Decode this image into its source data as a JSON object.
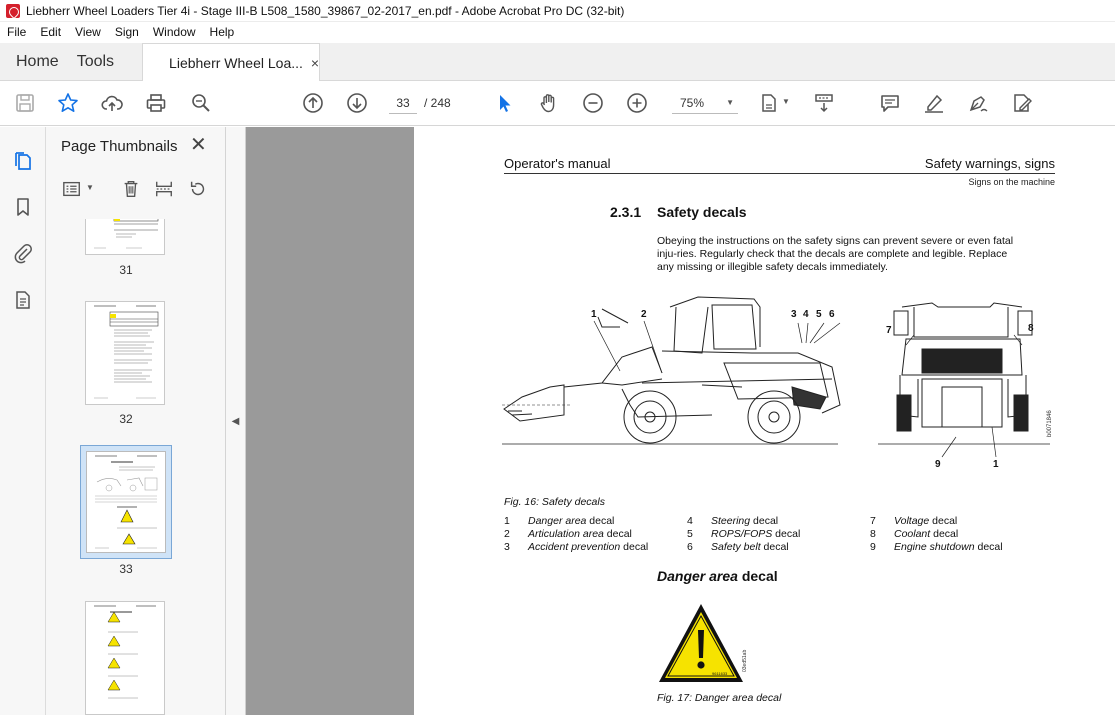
{
  "window": {
    "title": "Liebherr Wheel Loaders Tier 4i - Stage III-B L508_1580_39867_02-2017_en.pdf - Adobe Acrobat Pro DC (32-bit)"
  },
  "menu": [
    "File",
    "Edit",
    "View",
    "Sign",
    "Window",
    "Help"
  ],
  "tabs": {
    "home": "Home",
    "tools": "Tools",
    "document": "Liebherr Wheel Loa...",
    "close": "×"
  },
  "toolbar": {
    "current_page": "33",
    "total_pages": "/ 248",
    "zoom": "75%"
  },
  "panel": {
    "title": "Page Thumbnails",
    "close": "✕",
    "thumbnails": [
      {
        "label": "31"
      },
      {
        "label": "32"
      },
      {
        "label": "33",
        "selected": true
      },
      {
        "label": ""
      }
    ]
  },
  "doc": {
    "header_left": "Operator's manual",
    "header_right": "Safety warnings, signs",
    "header_sub": "Signs on the machine",
    "section_number": "2.3.1",
    "section_title": "Safety decals",
    "intro": "Obeying the instructions on the safety signs can prevent severe or even fatal inju-ries. Regularly check that the decals are complete and legible. Replace any missing or illegible safety decals immediately.",
    "figure_callouts": [
      "1",
      "2",
      "3",
      "4",
      "5",
      "6",
      "7",
      "8",
      "9",
      "1"
    ],
    "figure_code": "b0071846",
    "fig16_caption": "Fig. 16: Safety decals",
    "legend": [
      {
        "num": "1",
        "italic": "Danger area",
        "rest": " decal"
      },
      {
        "num": "2",
        "italic": "Articulation area",
        "rest": " decal"
      },
      {
        "num": "3",
        "italic": "Accident prevention",
        "rest": " decal"
      },
      {
        "num": "4",
        "italic": "Steering",
        "rest": " decal"
      },
      {
        "num": "5",
        "italic": "ROPS/FOPS",
        "rest": " decal"
      },
      {
        "num": "6",
        "italic": "Safety belt",
        "rest": " decal"
      },
      {
        "num": "7",
        "italic": "Voltage",
        "rest": " decal"
      },
      {
        "num": "8",
        "italic": "Coolant",
        "rest": " decal"
      },
      {
        "num": "9",
        "italic": "Engine shutdown",
        "rest": " decal"
      }
    ],
    "danger_heading_italic": "Danger area",
    "danger_heading_rest": " decal",
    "sign_code": "9611633",
    "sign_side_code": "03ed51ab",
    "fig17_caption": "Fig. 17: Danger area decal"
  },
  "colors": {
    "warning_yellow": "#f6e300",
    "acrobat_red": "#d4202c",
    "canvas_gray": "#9a9a9a",
    "icon_gray": "#555555",
    "accent_blue": "#1473e6"
  }
}
